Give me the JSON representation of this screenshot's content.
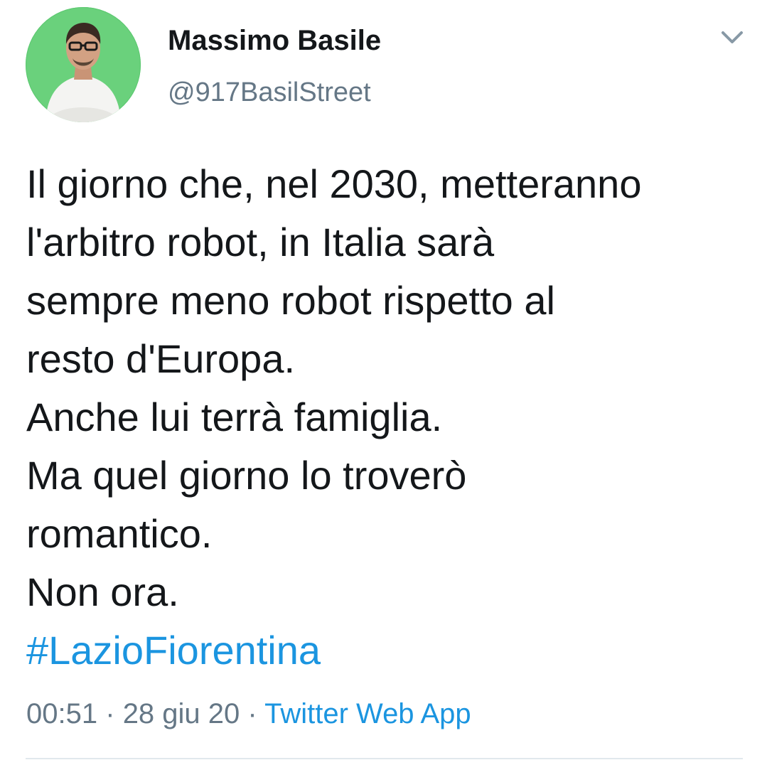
{
  "tweet": {
    "author_name": "Massimo Basile",
    "author_handle": "@917BasilStreet",
    "text_lines": [
      "Il giorno che, nel 2030, metteranno",
      "l'arbitro robot, in Italia sarà",
      "sempre meno robot rispetto al",
      "resto d'Europa.",
      "Anche lui terrà famiglia.",
      "Ma quel giorno lo troverò",
      "romantico.",
      "Non ora."
    ],
    "hashtag": "#LazioFiorentina",
    "time": "00:51",
    "separator": "·",
    "date": "28 giu 20",
    "source": "Twitter Web App"
  },
  "icons": {
    "menu": "chevron-down-icon",
    "avatar": "avatar-photo"
  },
  "colors": {
    "link": "#1b95e0",
    "secondary_text": "#657786",
    "primary_text": "#14171a",
    "avatar_background": "#5cc870",
    "divider": "#e1e8ed"
  }
}
